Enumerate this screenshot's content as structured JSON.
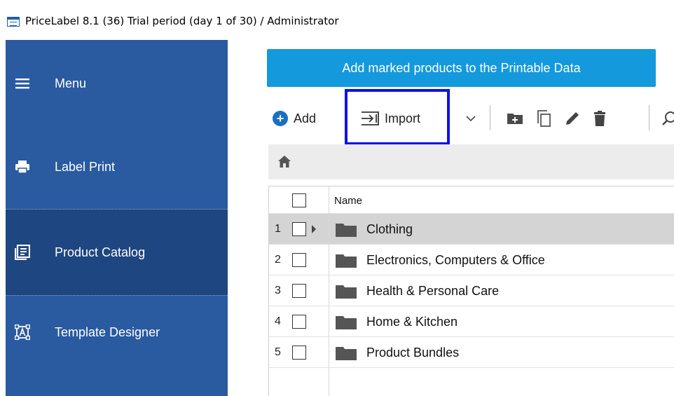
{
  "window": {
    "title": "PriceLabel 8.1 (36) Trial period (day 1 of 30) / Administrator"
  },
  "sidebar": {
    "menu_label": "Menu",
    "items": [
      {
        "label": "Label Print",
        "icon": "printer-icon"
      },
      {
        "label": "Product Catalog",
        "icon": "catalog-icon",
        "selected": true
      },
      {
        "label": "Template Designer",
        "icon": "template-designer-icon"
      }
    ]
  },
  "main": {
    "add_marked_label": "Add marked products to the Printable Data",
    "toolbar": {
      "add_label": "Add",
      "import_label": "Import"
    },
    "grid": {
      "column_name": "Name",
      "rows": [
        {
          "num": "1",
          "name": "Clothing"
        },
        {
          "num": "2",
          "name": "Electronics, Computers & Office"
        },
        {
          "num": "3",
          "name": "Health & Personal Care"
        },
        {
          "num": "4",
          "name": "Home & Kitchen"
        },
        {
          "num": "5",
          "name": "Product Bundles"
        }
      ]
    }
  },
  "colors": {
    "sidebar": "#2a5aa0",
    "sidebar_selected": "#1e4680",
    "accent_button": "#1499dd",
    "highlight_box": "#1010e8"
  }
}
